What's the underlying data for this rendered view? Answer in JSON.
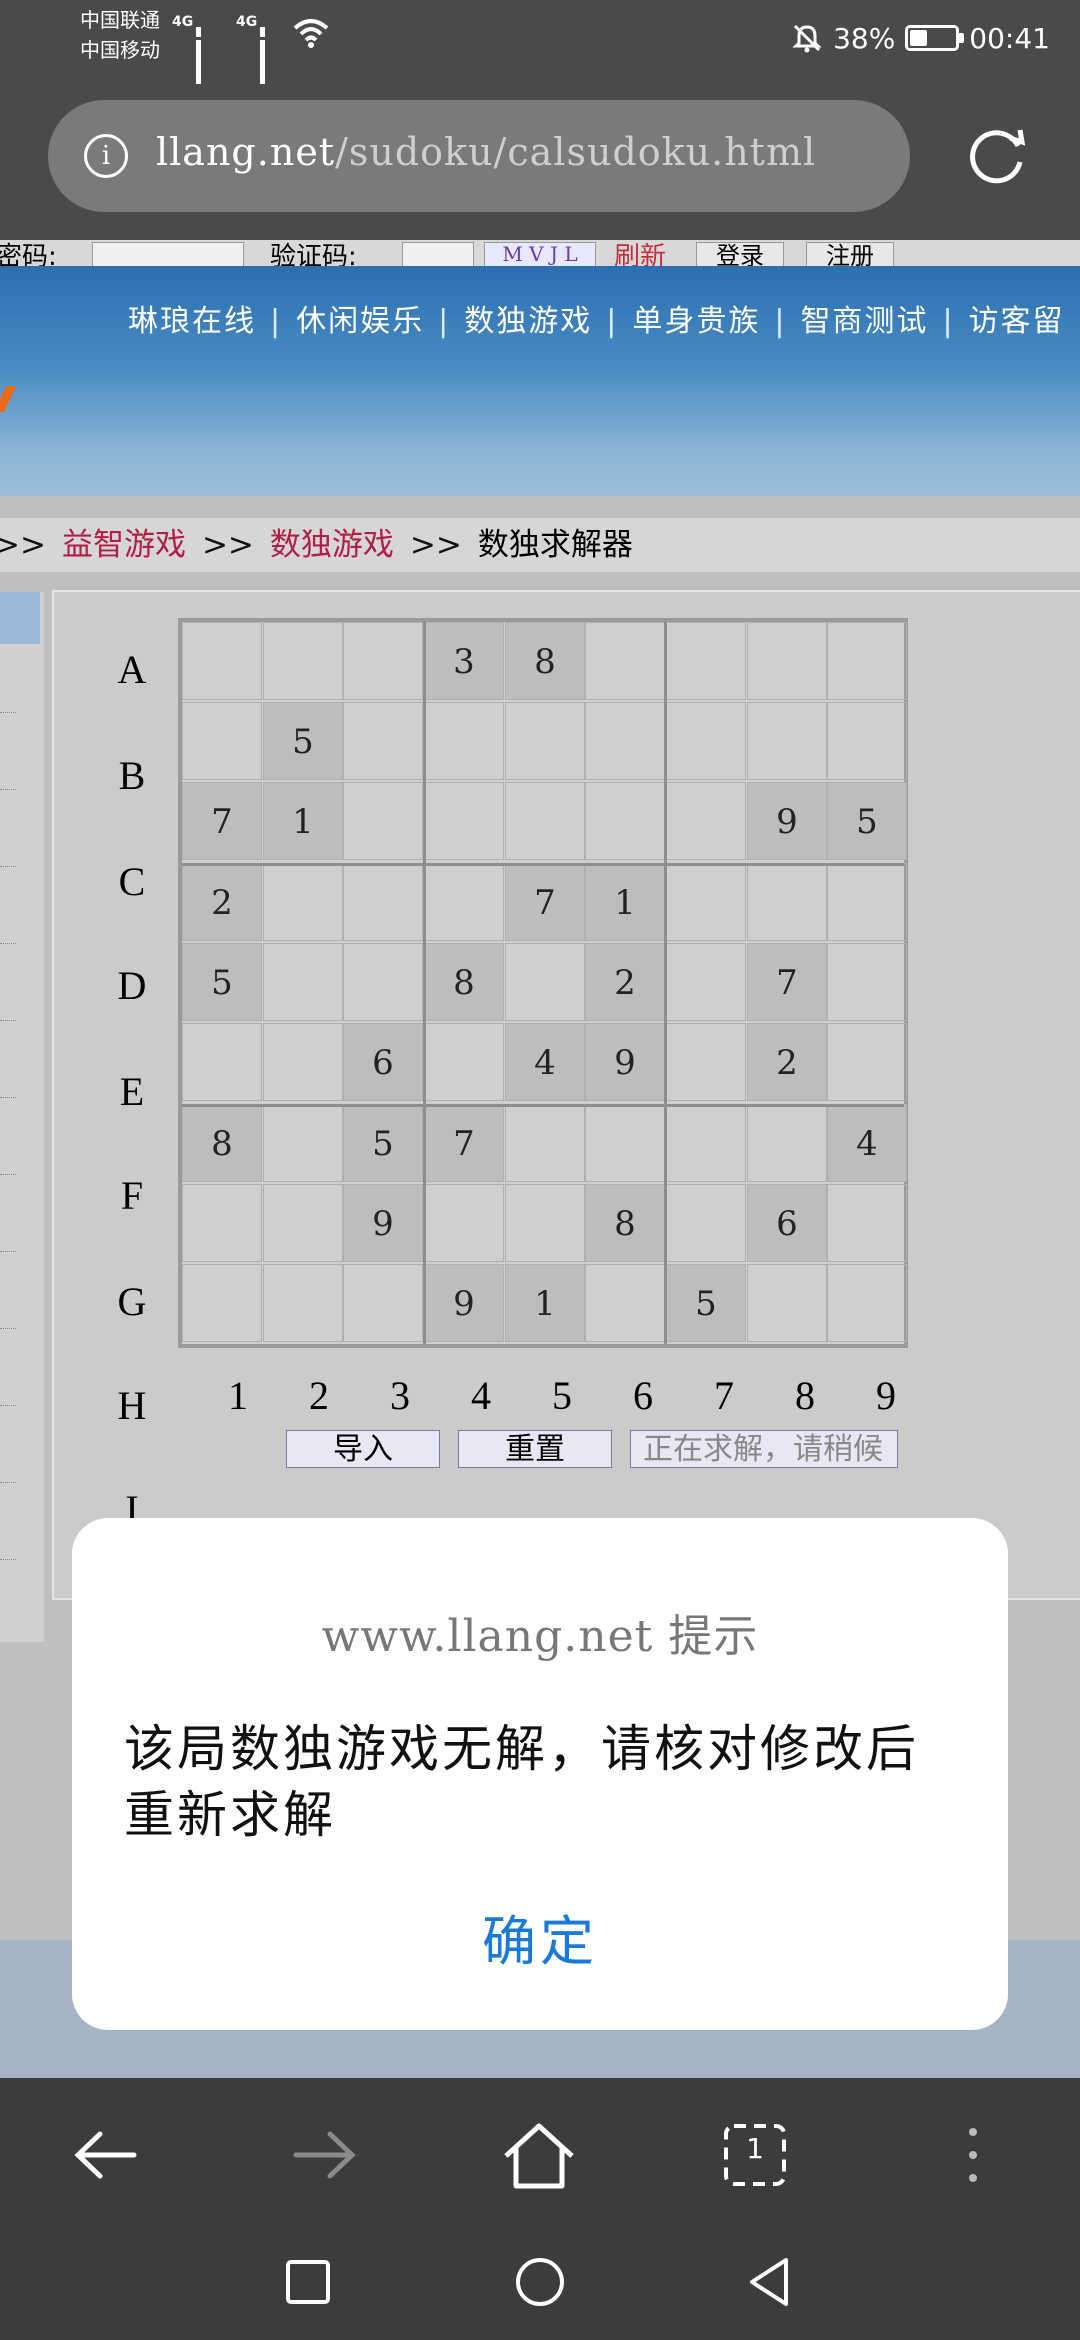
{
  "status_bar": {
    "carrier1": "中国联通",
    "carrier2": "中国移动",
    "net1": "4G",
    "net2": "4G",
    "battery_percent": "38%",
    "battery_level": 0.38,
    "time": "00:41",
    "icons": [
      "signal-icon",
      "wifi-icon",
      "mute-bell-icon",
      "battery-icon"
    ]
  },
  "address_bar": {
    "host": "llang.net",
    "path": "/sudoku/calsudoku.html",
    "icons": [
      "info-icon",
      "reload-icon"
    ]
  },
  "login_bar": {
    "password_label": "密码:",
    "captcha_label": "验证码:",
    "captcha_text": "M V J L",
    "refresh_link": "刷新",
    "login_button": "登录",
    "register_button": "注册"
  },
  "nav": {
    "items": [
      "琳琅在线",
      "休闲娱乐",
      "数独游戏",
      "单身贵族",
      "智商测试",
      "访客留"
    ]
  },
  "breadcrumb": {
    "items": [
      "益智游戏",
      "数独游戏",
      "数独求解器"
    ],
    "separator": ">>"
  },
  "sudoku": {
    "row_labels": [
      "A",
      "B",
      "C",
      "D",
      "E",
      "F",
      "G",
      "H",
      "I"
    ],
    "col_labels": [
      "1",
      "2",
      "3",
      "4",
      "5",
      "6",
      "7",
      "8",
      "9"
    ],
    "grid": [
      [
        "",
        "",
        "",
        "3",
        "8",
        "",
        "",
        "",
        ""
      ],
      [
        "",
        "5",
        "",
        "",
        "",
        "",
        "",
        "",
        ""
      ],
      [
        "7",
        "1",
        "",
        "",
        "",
        "",
        "",
        "9",
        "5"
      ],
      [
        "2",
        "",
        "",
        "",
        "7",
        "1",
        "",
        "",
        ""
      ],
      [
        "5",
        "",
        "",
        "8",
        "",
        "2",
        "",
        "7",
        ""
      ],
      [
        "",
        "",
        "6",
        "",
        "4",
        "9",
        "",
        "2",
        ""
      ],
      [
        "8",
        "",
        "5",
        "7",
        "",
        "",
        "",
        "",
        "4"
      ],
      [
        "",
        "",
        "9",
        "",
        "",
        "8",
        "",
        "6",
        ""
      ],
      [
        "",
        "",
        "",
        "9",
        "1",
        "",
        "5",
        "",
        ""
      ]
    ],
    "import_button": "导入",
    "reset_button": "重置",
    "solving_status": "正在求解，请稍候"
  },
  "dialog": {
    "title": "www.llang.net 提示",
    "message": "该局数独游戏无解，请核对修改后重新求解",
    "ok_button": "确定"
  },
  "browser_toolbar": {
    "icons": [
      "back-arrow-icon",
      "forward-arrow-icon",
      "home-icon",
      "tabs-icon",
      "more-icon"
    ],
    "tab_count": "1"
  },
  "system_nav": {
    "icons": [
      "recents-square-icon",
      "home-circle-icon",
      "back-triangle-icon"
    ]
  }
}
